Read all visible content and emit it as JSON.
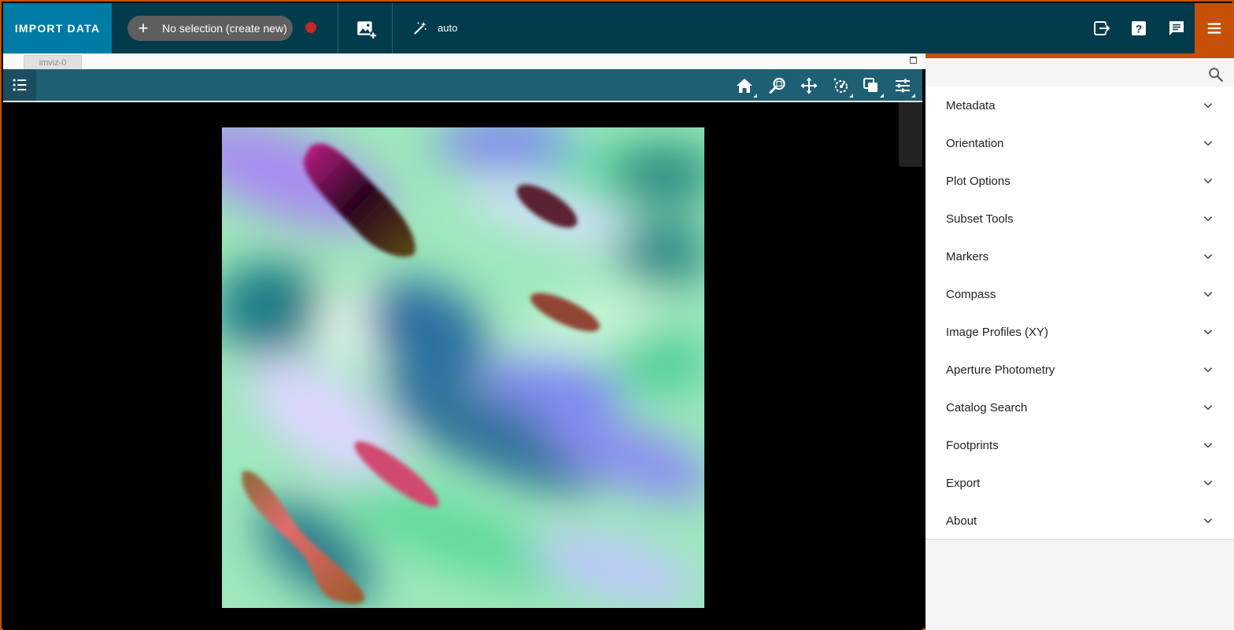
{
  "topbar": {
    "import_label": "IMPORT DATA",
    "selection_label": "No selection (create new)",
    "add_icon": "plus-icon",
    "record_color": "#c62828",
    "auto_label": "auto",
    "colors": {
      "bar": "#023b4b",
      "import": "#007ba6",
      "accent": "#c75109"
    }
  },
  "viewer": {
    "tab_label": "imviz-0",
    "tools": [
      "home-icon",
      "zoom-icon",
      "pan-icon",
      "stretch-icon",
      "blink-icon",
      "settings-icon"
    ]
  },
  "tray": {
    "plugins": [
      {
        "label": "Metadata"
      },
      {
        "label": "Orientation"
      },
      {
        "label": "Plot Options"
      },
      {
        "label": "Subset Tools"
      },
      {
        "label": "Markers"
      },
      {
        "label": "Compass"
      },
      {
        "label": "Image Profiles (XY)"
      },
      {
        "label": "Aperture Photometry"
      },
      {
        "label": "Catalog Search"
      },
      {
        "label": "Footprints"
      },
      {
        "label": "Export"
      },
      {
        "label": "About"
      }
    ]
  }
}
